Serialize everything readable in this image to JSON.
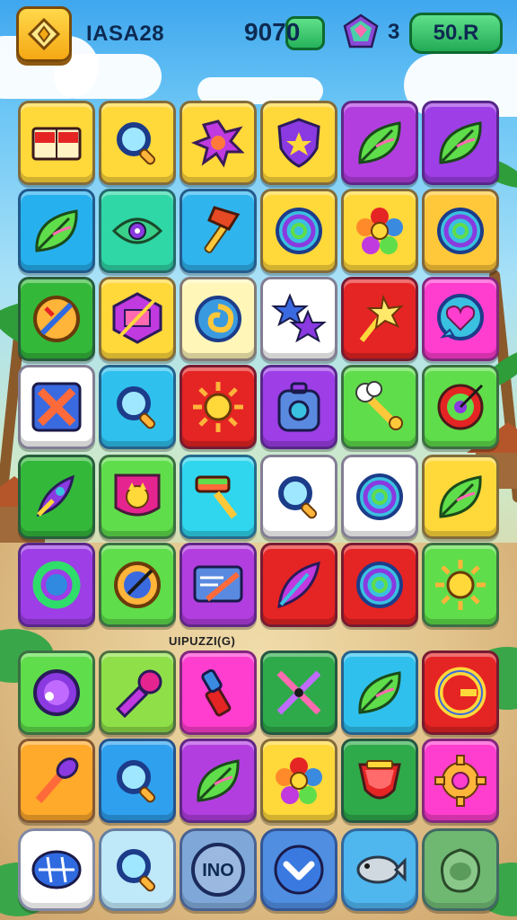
{
  "hud": {
    "player_name": "IASA28",
    "score": "9070",
    "gem_count": "3",
    "coins": "50.R",
    "icons": {
      "menu": "menu-diamond-icon",
      "gem": "gem-icon"
    }
  },
  "section_label": "UIPUZZI(G)",
  "bottom_bar": {
    "items": [
      {
        "name": "bottom-oval-button",
        "icon": "oval-stripes-icon",
        "color": "#ffffff"
      },
      {
        "name": "bottom-magnifier-button",
        "icon": "magnifier-icon",
        "color": "#bfe8f8"
      },
      {
        "name": "bottom-no-button",
        "label": "INO",
        "color": "#7fa8d8"
      },
      {
        "name": "bottom-chevron-button",
        "icon": "chevron-down-icon",
        "color": "#4f8ee0"
      },
      {
        "name": "bottom-fish-button",
        "icon": "fish-icon",
        "color": "#4fb6ee"
      },
      {
        "name": "bottom-stone-button",
        "icon": "stone-icon",
        "color": "#6fb872"
      }
    ]
  },
  "grid": {
    "rows": [
      [
        {
          "icon": "book-icon",
          "color": "#ffd83a"
        },
        {
          "icon": "magnifier-icon",
          "color": "#ffd83a"
        },
        {
          "icon": "splat-icon",
          "color": "#ffd83a"
        },
        {
          "icon": "shield-star-icon",
          "color": "#ffd83a"
        },
        {
          "icon": "leaf-icon",
          "color": "#b23ee0"
        },
        {
          "icon": "leaf-icon",
          "color": "#9d3ee6"
        }
      ],
      [
        {
          "icon": "leaf-icon",
          "color": "#27b0ee"
        },
        {
          "icon": "eye-leaf-icon",
          "color": "#2fd6a6"
        },
        {
          "icon": "hammer-icon",
          "color": "#2fb4ee"
        },
        {
          "icon": "spiral-icon",
          "color": "#ffd83a"
        },
        {
          "icon": "flower-icon",
          "color": "#ffd83a"
        },
        {
          "icon": "spiral-icon",
          "color": "#ffc83a"
        }
      ],
      [
        {
          "icon": "ban-coin-icon",
          "color": "#34b83a"
        },
        {
          "icon": "cube-icon",
          "color": "#ffd83a"
        },
        {
          "icon": "swirl-icon",
          "color": "#fff6b8"
        },
        {
          "icon": "stars-icon",
          "color": "#ffffff"
        },
        {
          "icon": "wand-icon",
          "color": "#e52424"
        },
        {
          "icon": "heart-bubble-icon",
          "color": "#ff3ecf"
        }
      ],
      [
        {
          "icon": "x-cross-icon",
          "color": "#ffffff"
        },
        {
          "icon": "magnifier-icon",
          "color": "#2fc0ee"
        },
        {
          "icon": "sun-icon",
          "color": "#e52424"
        },
        {
          "icon": "gear-bag-icon",
          "color": "#9d3ee6"
        },
        {
          "icon": "bone-icon",
          "color": "#5fdd4a"
        },
        {
          "icon": "target-icon",
          "color": "#5fdd4a"
        }
      ],
      [
        {
          "icon": "rocket-icon",
          "color": "#34b83a"
        },
        {
          "icon": "cat-badge-icon",
          "color": "#5fdd4a"
        },
        {
          "icon": "brush-icon",
          "color": "#2fd6ee"
        },
        {
          "icon": "magnifier-icon",
          "color": "#ffffff"
        },
        {
          "icon": "spiral-icon",
          "color": "#ffffff"
        },
        {
          "icon": "leaf-icon",
          "color": "#ffd83a"
        }
      ],
      [
        {
          "icon": "ring-icon",
          "color": "#9d3ee6"
        },
        {
          "icon": "compass-icon",
          "color": "#5fdd4a"
        },
        {
          "icon": "card-icon",
          "color": "#b23ee0"
        },
        {
          "icon": "feather-icon",
          "color": "#e52424"
        },
        {
          "icon": "spiral-icon",
          "color": "#e52424"
        },
        {
          "icon": "sun-icon",
          "color": "#5fdd4a"
        }
      ],
      [
        {
          "icon": "orb-icon",
          "color": "#5fdd4a"
        },
        {
          "icon": "trumpet-icon",
          "color": "#8fe048"
        },
        {
          "icon": "lipstick-icon",
          "color": "#ff3ecf"
        },
        {
          "icon": "crossed-swords-icon",
          "color": "#2faa4a"
        },
        {
          "icon": "leaf-icon",
          "color": "#2fc0ee"
        },
        {
          "icon": "g-ring-icon",
          "color": "#e52424"
        }
      ],
      [
        {
          "icon": "torch-icon",
          "color": "#ffaa2a"
        },
        {
          "icon": "magnifier-icon",
          "color": "#2fa0ee"
        },
        {
          "icon": "leaf-icon",
          "color": "#b23ee0"
        },
        {
          "icon": "flower-icon",
          "color": "#ffd83a"
        },
        {
          "icon": "gem-icon",
          "color": "#2faa4a"
        },
        {
          "icon": "gear-icon",
          "color": "#ff3ecf"
        }
      ]
    ]
  }
}
